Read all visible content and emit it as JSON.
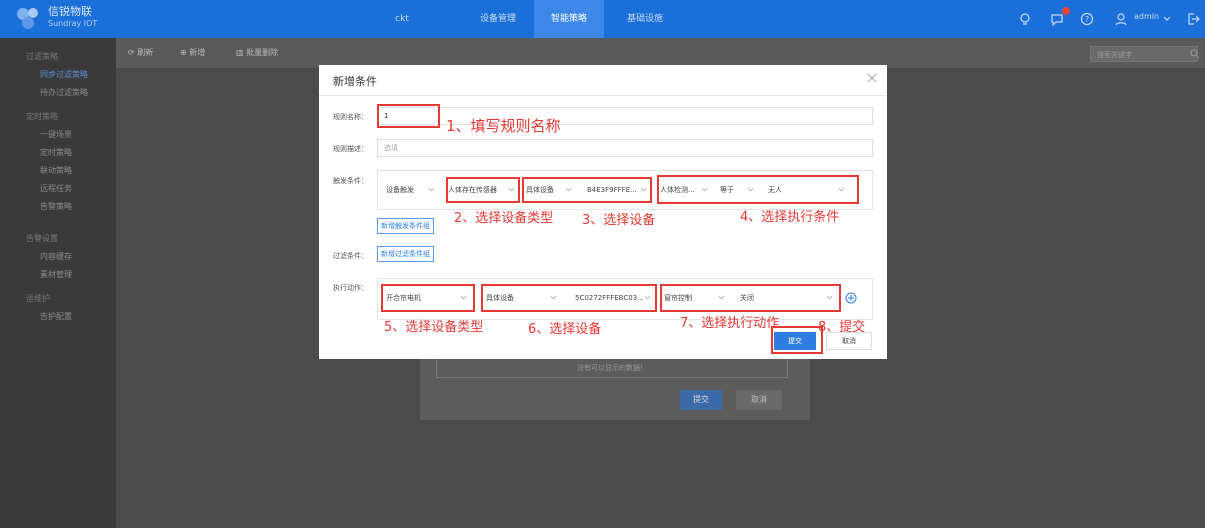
{
  "topbar": {
    "brand": "信锐物联",
    "brand_sub": "Sundray IOT",
    "nav": [
      "ckt",
      "设备管理",
      "智能策略",
      "基础设施"
    ],
    "active_nav": "智能策略",
    "notification_count": "2",
    "user": "admin"
  },
  "sidebar": {
    "items": [
      {
        "label": "过滤策略",
        "group": true
      },
      {
        "label": "同步过滤策略",
        "active": true
      },
      {
        "label": "待办过滤策略"
      },
      {
        "label": "定时策略",
        "group": true
      },
      {
        "label": "一键场景"
      },
      {
        "label": "定时策略"
      },
      {
        "label": "联动策略"
      },
      {
        "label": "远程任务"
      },
      {
        "label": "告警策略"
      },
      {
        "label": "告警设置",
        "group": true
      },
      {
        "label": "内容缓存"
      },
      {
        "label": "素材管理"
      },
      {
        "label": "运维护",
        "group": true
      },
      {
        "label": "告护配置"
      }
    ]
  },
  "toolbar": {
    "refresh": "刷新",
    "add": "新增",
    "delete": "批量删除",
    "search_placeholder": "搜索关键字"
  },
  "background": {
    "empty_message": "没有可以显示的数据！",
    "submit": "提交",
    "cancel": "取消"
  },
  "modal": {
    "title": "新增条件",
    "rule_name_label": "规则名称：",
    "rule_name_value": "1",
    "rule_desc_label": "规则描述：",
    "rule_desc_placeholder": "选填",
    "trigger_label": "触发条件：",
    "trigger": {
      "type": "设备触发",
      "device_type": "人体存在传感器",
      "device_scope": "具体设备",
      "device": "B4E3F9FFFE...",
      "attribute": "人体检测...",
      "operator": "等于",
      "value": "无人"
    },
    "add_trigger_group": "新增触发条件组",
    "filter_label": "过滤条件：",
    "add_filter_group": "新增过滤条件组",
    "action_label": "执行动作：",
    "action": {
      "device_type": "开合帘电机",
      "device_scope": "具体设备",
      "device": "5C0272FFFEBC03...",
      "action": "窗帘控制",
      "value": "关闭"
    },
    "submit": "提交",
    "cancel": "取消"
  },
  "annotations": [
    "1、填写规则名称",
    "2、选择设备类型",
    "3、选择设备",
    "4、选择执行条件",
    "5、选择设备类型",
    "6、选择设备",
    "7、选择执行动作",
    "8、提交"
  ],
  "colors": {
    "primary": "#2f7de1",
    "topbar": "#1a6fd8",
    "annotation": "#e53935"
  }
}
